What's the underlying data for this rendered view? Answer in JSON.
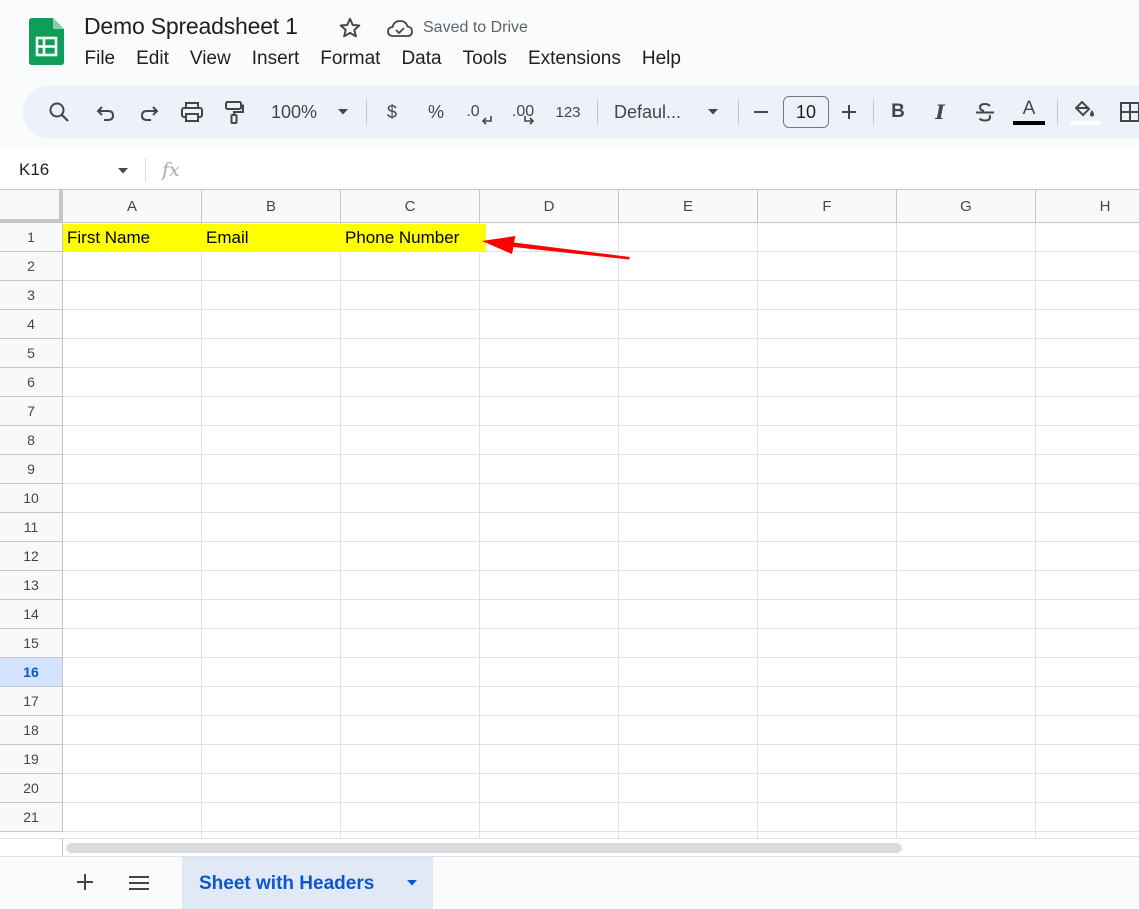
{
  "app": {
    "title": "Demo Spreadsheet 1",
    "save_status": "Saved to Drive",
    "logo_icon": "sheets-logo-icon",
    "brand_color": "#0f9d58"
  },
  "menu": [
    "File",
    "Edit",
    "View",
    "Insert",
    "Format",
    "Data",
    "Tools",
    "Extensions",
    "Help"
  ],
  "toolbar": {
    "zoom": "100%",
    "currency_label": "$",
    "percent_label": "%",
    "decrease_decimal_label": ".0",
    "increase_decimal_label": ".00",
    "format_label": "123",
    "font": "Defaul...",
    "font_size": "10",
    "bold_label": "B",
    "italic_label": "I",
    "text_color_label": "A",
    "icons": [
      "search-icon",
      "undo-icon",
      "redo-icon",
      "print-icon",
      "paint-format-icon",
      "minus-icon",
      "plus-icon",
      "strikethrough-icon",
      "fill-color-icon",
      "borders-icon"
    ]
  },
  "formula_bar": {
    "name_box": "K16",
    "fx_label": "fx",
    "formula": ""
  },
  "grid": {
    "columns": [
      "A",
      "B",
      "C",
      "D",
      "E",
      "F",
      "G",
      "H"
    ],
    "rows": [
      "1",
      "2",
      "3",
      "4",
      "5",
      "6",
      "7",
      "8",
      "9",
      "10",
      "11",
      "12",
      "13",
      "14",
      "15",
      "16",
      "17",
      "18",
      "19",
      "20",
      "21"
    ],
    "selected_row": "16",
    "row1": {
      "A": "First Name",
      "B": "Email",
      "C": "Phone Number"
    },
    "highlight_color": "#ffff00",
    "annotation": {
      "type": "red-arrow",
      "color": "#ff0000",
      "points_to": "C1"
    }
  },
  "sheets": {
    "active": "Sheet with Headers",
    "add_icon": "plus-icon",
    "list_icon": "menu-icon"
  }
}
